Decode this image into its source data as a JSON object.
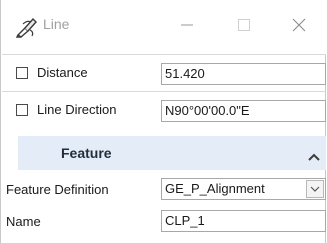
{
  "window": {
    "title": "Line",
    "app_icon": "pen-stylus-icon",
    "controls": [
      "minimize-icon",
      "maximize-icon",
      "close-icon"
    ]
  },
  "fields": {
    "distance": {
      "label": "Distance",
      "value": "51.420",
      "checked": false
    },
    "line_direction": {
      "label": "Line Direction",
      "value": "N90°00'00.0\"E",
      "checked": false
    }
  },
  "section": {
    "title": "Feature",
    "collapse_icon": "chevron-up-icon"
  },
  "feature": {
    "definition_label": "Feature Definition",
    "definition_value": "GE_P_Alignment",
    "name_label": "Name",
    "name_value": "CLP_1"
  },
  "colors": {
    "section_header_bg": "#e4ecf7",
    "title_text": "#a0a0a0"
  }
}
